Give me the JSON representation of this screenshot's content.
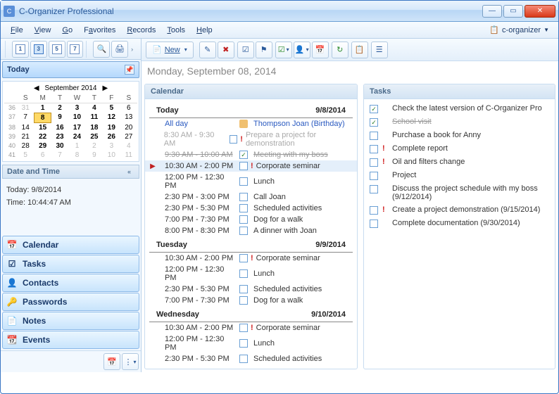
{
  "window": {
    "title": "C-Organizer Professional"
  },
  "menu": {
    "file": "File",
    "view": "View",
    "go": "Go",
    "favorites": "Favorites",
    "records": "Records",
    "tools": "Tools",
    "help": "Help",
    "profile": "c-organizer"
  },
  "left": {
    "today": "Today",
    "month_name": "September 2014",
    "week_headers": [
      "S",
      "M",
      "T",
      "W",
      "T",
      "F",
      "S"
    ],
    "weeks": [
      {
        "wk": "36",
        "days": [
          {
            "n": "31",
            "dim": true
          },
          {
            "n": "1",
            "bold": true
          },
          {
            "n": "2",
            "bold": true
          },
          {
            "n": "3",
            "bold": true
          },
          {
            "n": "4",
            "bold": true
          },
          {
            "n": "5",
            "bold": true
          },
          {
            "n": "6"
          }
        ]
      },
      {
        "wk": "37",
        "days": [
          {
            "n": "7"
          },
          {
            "n": "8",
            "today": true,
            "bold": true
          },
          {
            "n": "9",
            "bold": true
          },
          {
            "n": "10",
            "bold": true
          },
          {
            "n": "11",
            "bold": true
          },
          {
            "n": "12",
            "bold": true
          },
          {
            "n": "13"
          }
        ]
      },
      {
        "wk": "38",
        "days": [
          {
            "n": "14"
          },
          {
            "n": "15",
            "bold": true
          },
          {
            "n": "16",
            "bold": true
          },
          {
            "n": "17",
            "bold": true
          },
          {
            "n": "18",
            "bold": true
          },
          {
            "n": "19",
            "bold": true
          },
          {
            "n": "20"
          }
        ]
      },
      {
        "wk": "39",
        "days": [
          {
            "n": "21"
          },
          {
            "n": "22",
            "bold": true
          },
          {
            "n": "23",
            "bold": true
          },
          {
            "n": "24",
            "bold": true
          },
          {
            "n": "25",
            "bold": true
          },
          {
            "n": "26",
            "bold": true
          },
          {
            "n": "27"
          }
        ]
      },
      {
        "wk": "40",
        "days": [
          {
            "n": "28"
          },
          {
            "n": "29",
            "bold": true
          },
          {
            "n": "30",
            "bold": true
          },
          {
            "n": "1",
            "dim": true
          },
          {
            "n": "2",
            "dim": true
          },
          {
            "n": "3",
            "dim": true
          },
          {
            "n": "4",
            "dim": true
          }
        ]
      },
      {
        "wk": "41",
        "days": [
          {
            "n": "5",
            "dim": true
          },
          {
            "n": "6",
            "dim": true
          },
          {
            "n": "7",
            "dim": true
          },
          {
            "n": "8",
            "dim": true
          },
          {
            "n": "9",
            "dim": true
          },
          {
            "n": "10",
            "dim": true
          },
          {
            "n": "11",
            "dim": true
          }
        ]
      }
    ],
    "date_time_hdr": "Date and Time",
    "today_line": "Today: 9/8/2014",
    "time_line": "Time: 10:44:47 AM",
    "nav": [
      {
        "label": "Calendar",
        "icon": "📅"
      },
      {
        "label": "Tasks",
        "icon": "☑"
      },
      {
        "label": "Contacts",
        "icon": "👤"
      },
      {
        "label": "Passwords",
        "icon": "🔑"
      },
      {
        "label": "Notes",
        "icon": "📄"
      },
      {
        "label": "Events",
        "icon": "📆"
      }
    ]
  },
  "main": {
    "date_header": "Monday, September 08, 2014",
    "new_label": "New",
    "calendar_hdr": "Calendar",
    "tasks_hdr": "Tasks",
    "days": [
      {
        "name": "Today",
        "date": "9/8/2014",
        "rows": [
          {
            "time": "All day",
            "allday": true,
            "icon": "person",
            "text": "Thompson Joan (Birthday)",
            "link": true
          },
          {
            "time": "8:30 AM - 9:30 AM",
            "dim": true,
            "bang": true,
            "text": "Prepare a project for demonstration",
            "textdim": true
          },
          {
            "time": "9:30 AM - 10:00 AM",
            "struck": true,
            "checked": true,
            "text": "Meeting with my boss"
          },
          {
            "time": "10:30 AM - 2:00 PM",
            "current": true,
            "sel": true,
            "bang": true,
            "text": "Corporate seminar"
          },
          {
            "time": "12:00 PM - 12:30 PM",
            "text": "Lunch"
          },
          {
            "time": "2:30 PM - 3:00 PM",
            "text": "Call Joan"
          },
          {
            "time": "2:30 PM - 5:30 PM",
            "text": "Scheduled activities"
          },
          {
            "time": "7:00 PM - 7:30 PM",
            "text": "Dog for a walk"
          },
          {
            "time": "8:00 PM - 8:30 PM",
            "text": "A dinner with Joan"
          }
        ]
      },
      {
        "name": "Tuesday",
        "date": "9/9/2014",
        "rows": [
          {
            "time": "10:30 AM - 2:00 PM",
            "bang": true,
            "text": "Corporate seminar"
          },
          {
            "time": "12:00 PM - 12:30 PM",
            "text": "Lunch"
          },
          {
            "time": "2:30 PM - 5:30 PM",
            "text": "Scheduled activities"
          },
          {
            "time": "7:00 PM - 7:30 PM",
            "text": "Dog for a walk"
          }
        ]
      },
      {
        "name": "Wednesday",
        "date": "9/10/2014",
        "rows": [
          {
            "time": "10:30 AM - 2:00 PM",
            "bang": true,
            "text": "Corporate seminar"
          },
          {
            "time": "12:00 PM - 12:30 PM",
            "text": "Lunch"
          },
          {
            "time": "2:30 PM - 5:30 PM",
            "text": "Scheduled activities"
          }
        ]
      }
    ],
    "tasks": [
      {
        "checked": true,
        "text": "Check the latest version of C-Organizer Pro"
      },
      {
        "checked": true,
        "done": true,
        "text": "School visit"
      },
      {
        "text": "Purchase a book for Anny"
      },
      {
        "bang": true,
        "text": "Complete report"
      },
      {
        "bang": true,
        "text": "Oil and filters change"
      },
      {
        "text": "Project"
      },
      {
        "text": "Discuss the project schedule with my boss (9/12/2014)"
      },
      {
        "bang": true,
        "text": "Create a project demonstration (9/15/2014)"
      },
      {
        "text": "Complete documentation (9/30/2014)"
      }
    ]
  },
  "toolbar_cal_numbers": [
    "1",
    "3",
    "5",
    "7"
  ]
}
